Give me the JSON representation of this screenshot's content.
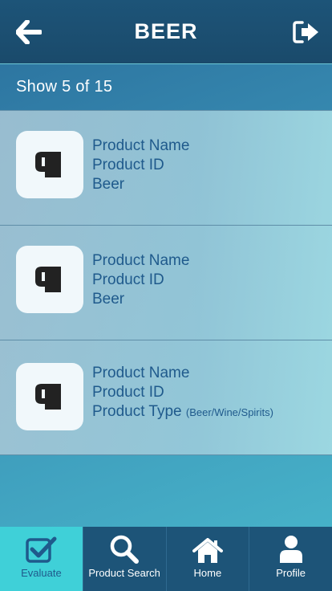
{
  "header": {
    "title": "BEER",
    "back_icon": "arrow-left-icon",
    "logout_icon": "sign-out-icon"
  },
  "count_text": "Show 5 of 15",
  "products": [
    {
      "name": "Product Name",
      "id": "Product ID",
      "type": "Beer",
      "type_note": "",
      "icon": "beer-mug-icon"
    },
    {
      "name": "Product Name",
      "id": "Product ID",
      "type": "Beer",
      "type_note": "",
      "icon": "beer-mug-icon"
    },
    {
      "name": "Product Name",
      "id": "Product ID",
      "type": "Product Type",
      "type_note": "(Beer/Wine/Spirits)",
      "icon": "beer-mug-icon"
    }
  ],
  "tabs": [
    {
      "label": "Evaluate",
      "icon": "checkbox-icon",
      "active": true
    },
    {
      "label": "Product Search",
      "icon": "search-icon",
      "active": false
    },
    {
      "label": "Home",
      "icon": "home-icon",
      "active": false
    },
    {
      "label": "Profile",
      "icon": "user-icon",
      "active": false
    }
  ],
  "colors": {
    "header": "#1d5478",
    "accent": "#3fd0d8",
    "text_blue": "#1f5a8c"
  }
}
